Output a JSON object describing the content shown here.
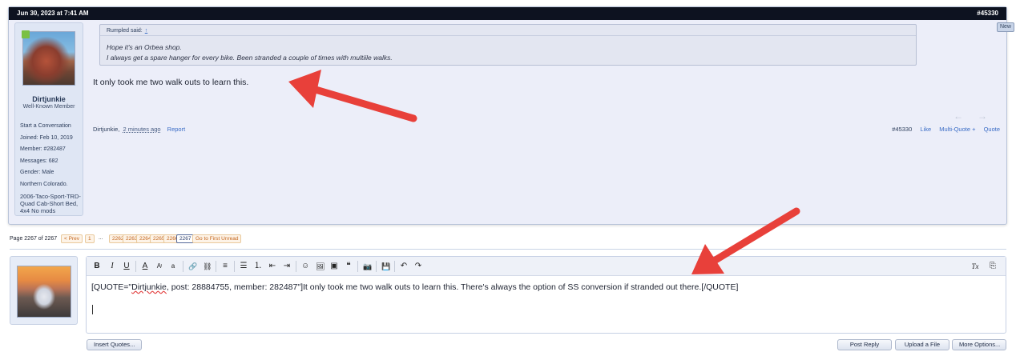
{
  "post": {
    "date": "Jun 30, 2023 at 7:41 AM",
    "number": "#45330",
    "new_badge": "New",
    "user": {
      "name": "Dirtjunkie",
      "role": "Well-Known Member",
      "start_conversation": "Start a Conversation",
      "joined": "Joined: Feb 10, 2019",
      "member": "Member: #282487",
      "messages": "Messages: 682",
      "gender": "Gender: Male",
      "location": "Northern Colorado.",
      "signature": "2006-Taco-Sport-TRD-Quad Cab-Short Bed, 4x4 No mods"
    },
    "quote": {
      "author": "Rumpled said:",
      "arrow": "↑",
      "line1": "Hope it's an Orbea shop.",
      "line2": "I always get a spare hanger for every bike. Been stranded a couple of times with multiile walks."
    },
    "message": "It only took me two walk outs to learn this.",
    "footer": {
      "author": "Dirtjunkie,",
      "time": "2 minutes ago",
      "report": "Report"
    },
    "actions": {
      "number": "#45330",
      "like": "Like",
      "multiquote": "Multi-Quote +",
      "quote": "Quote"
    }
  },
  "pagination": {
    "label": "Page 2267 of 2267",
    "prev": "< Prev",
    "first": "1",
    "ellipsis": "...",
    "pages": [
      "2262",
      "2263",
      "2264",
      "2265",
      "2266",
      "2267"
    ],
    "first_unread": "Go to First Unread"
  },
  "editor": {
    "quote_open": "[QUOTE=\"",
    "quote_name": "Dirtjunkie",
    "quote_rest": ", post: 28884755, member: 282487\"]It only took me two walk outs to learn this. There's always the option of SS conversion if stranded out there.[/QUOTE]",
    "toolbar": {
      "bold": "B",
      "italic": "I",
      "underline": "U",
      "font_color": "A",
      "font_size": "Aᵎ",
      "font_family": "a",
      "link": "🔗",
      "unlink": "⛓",
      "align": "≡",
      "bullet_list": "☰",
      "numbered_list": "⒈",
      "outdent": "⇤",
      "indent": "⇥",
      "smilies": "☺",
      "image": "🖼",
      "media": "▣",
      "quote": "❝",
      "camera": "📷",
      "save_draft": "💾",
      "undo": "↶",
      "redo": "↷",
      "remove_format": "Tx",
      "toggle_bbcode": "⎘"
    }
  },
  "buttons": {
    "insert_quotes": "Insert Quotes...",
    "post_reply": "Post Reply",
    "upload_file": "Upload a File",
    "more_options": "More Options..."
  },
  "colors": {
    "header_bg": "#0d1220",
    "post_bg": "#eceef9",
    "link": "#3a6cc6",
    "annotation_arrow": "#e8403a"
  }
}
